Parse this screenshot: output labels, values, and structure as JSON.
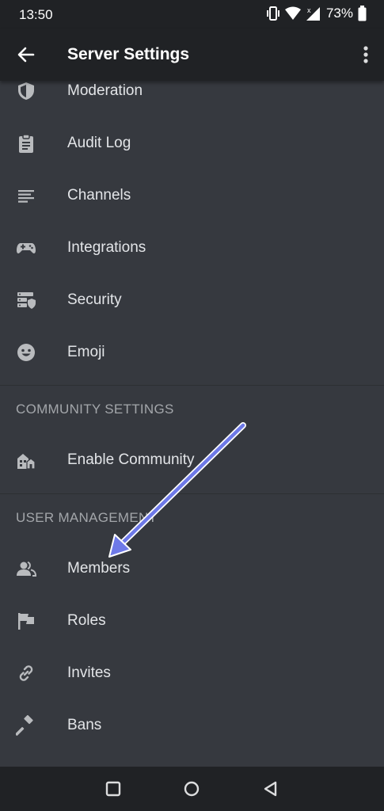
{
  "status_bar": {
    "time": "13:50",
    "battery": "73%"
  },
  "app_bar": {
    "title": "Server Settings"
  },
  "menu": {
    "moderation": "Moderation",
    "audit_log": "Audit Log",
    "channels": "Channels",
    "integrations": "Integrations",
    "security": "Security",
    "emoji": "Emoji",
    "community_header": "COMMUNITY SETTINGS",
    "enable_community": "Enable Community",
    "user_management_header": "USER MANAGEMENT",
    "members": "Members",
    "roles": "Roles",
    "invites": "Invites",
    "bans": "Bans"
  },
  "colors": {
    "background": "#36393f",
    "bar": "#202225",
    "icon": "#b9bbbe",
    "arrow": "#6e79e8"
  }
}
